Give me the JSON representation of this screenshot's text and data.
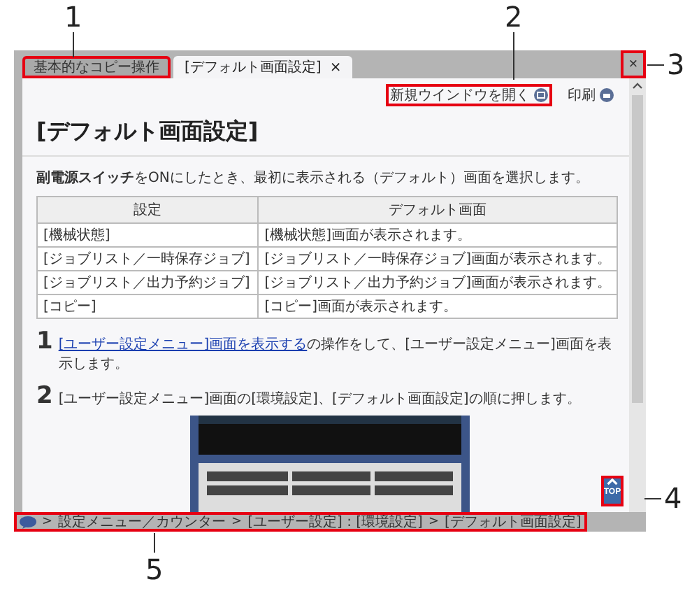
{
  "callouts": [
    "1",
    "2",
    "3",
    "4",
    "5"
  ],
  "window": {
    "tabs": [
      {
        "label": "基本的なコピー操作",
        "selected": false
      },
      {
        "label": "[デフォルト画面設定]",
        "selected": true,
        "close": "×"
      }
    ],
    "close": "×",
    "toolbar": {
      "new_window": "新規ウインドウを開く",
      "print": "印刷"
    },
    "heading": "[デフォルト画面設定]",
    "intro": "**副電源スイッチ**をONにしたとき、最初に表示される（デフォルト）画面を選択します。",
    "table": {
      "columns": [
        "設定",
        "デフォルト画面"
      ],
      "rows": [
        [
          "[機械状態]",
          "[機械状態]画面が表示されます。"
        ],
        [
          "[ジョブリスト／一時保存ジョブ]",
          "[ジョブリスト／一時保存ジョブ]画面が表示されます。"
        ],
        [
          "[ジョブリスト／出力予約ジョブ]",
          "[ジョブリスト／出力予約ジョブ]画面が表示されます。"
        ],
        [
          "[コピー]",
          "[コピー]画面が表示されます。"
        ]
      ]
    },
    "steps": [
      {
        "number": "1",
        "link": "[ユーザー設定メニュー]画面を表示する",
        "text": "の操作をして、[ユーザー設定メニュー]画面を表示します。"
      },
      {
        "number": "2",
        "text": "[ユーザー設定メニュー]画面の[環境設定]、[デフォルト画面設定]の順に押します。"
      }
    ],
    "top_button": "TOP",
    "breadcrumb": [
      {
        "separator": ">",
        "label": "設定メニュー／カウンター"
      },
      {
        "separator": ">",
        "label": "[ユーザー設定] : [環境設定]"
      },
      {
        "separator": ">",
        "label": "[デフォルト画面設定]"
      }
    ]
  }
}
